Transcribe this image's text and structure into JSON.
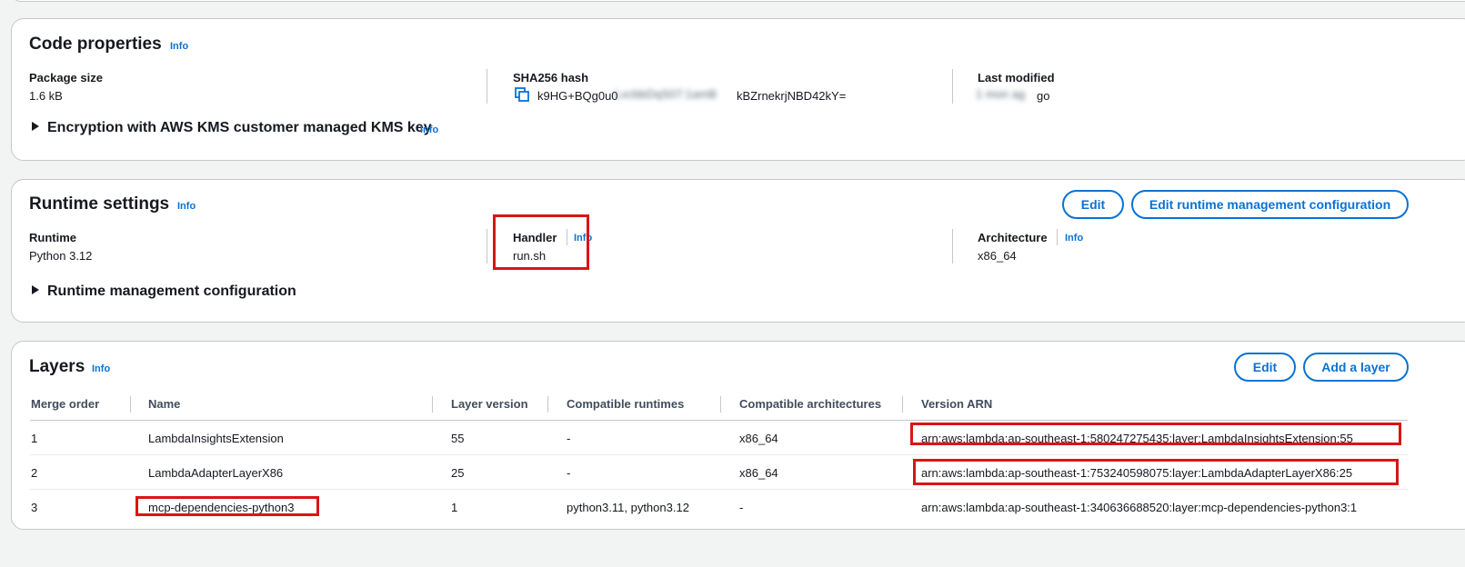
{
  "code_properties": {
    "title": "Code properties",
    "info": "Info",
    "package_size_label": "Package size",
    "package_size_value": "1.6 kB",
    "sha_label": "SHA256 hash",
    "sha_value_start": "k9HG+BQg0u0",
    "sha_value_end": "kBZrnekrjNBD42kY=",
    "last_modified_label": "Last modified",
    "last_modified_value_end": "go",
    "encryption_expander": "Encryption with AWS KMS customer managed KMS key",
    "encryption_info": "Info"
  },
  "runtime_settings": {
    "title": "Runtime settings",
    "info": "Info",
    "edit_button": "Edit",
    "edit_runtime_mgmt_button": "Edit runtime management configuration",
    "runtime_label": "Runtime",
    "runtime_value": "Python 3.12",
    "handler_label": "Handler",
    "handler_info": "Info",
    "handler_value": "run.sh",
    "architecture_label": "Architecture",
    "architecture_info": "Info",
    "architecture_value": "x86_64",
    "runtime_mgmt_expander": "Runtime management configuration"
  },
  "layers": {
    "title": "Layers",
    "info": "Info",
    "edit_button": "Edit",
    "add_layer_button": "Add a layer",
    "columns": [
      "Merge order",
      "Name",
      "Layer version",
      "Compatible runtimes",
      "Compatible architectures",
      "Version ARN"
    ],
    "rows": [
      {
        "merge_order": "1",
        "name": "LambdaInsightsExtension",
        "version": "55",
        "runtimes": "-",
        "architectures": "x86_64",
        "arn": "arn:aws:lambda:ap-southeast-1:580247275435:layer:LambdaInsightsExtension:55"
      },
      {
        "merge_order": "2",
        "name": "LambdaAdapterLayerX86",
        "version": "25",
        "runtimes": "-",
        "architectures": "x86_64",
        "arn": "arn:aws:lambda:ap-southeast-1:753240598075:layer:LambdaAdapterLayerX86:25"
      },
      {
        "merge_order": "3",
        "name": "mcp-dependencies-python3",
        "version": "1",
        "runtimes": "python3.11, python3.12",
        "architectures": "-",
        "arn": "arn:aws:lambda:ap-southeast-1:340636688520:layer:mcp-dependencies-python3:1"
      }
    ]
  },
  "colors": {
    "accent": "#0972d3",
    "highlight": "#d91515",
    "text": "#16191f",
    "border": "#c6c6cd",
    "background": "#f2f3f3"
  },
  "icons": {
    "copy": "copy-icon",
    "expand": "caret-right-icon"
  }
}
